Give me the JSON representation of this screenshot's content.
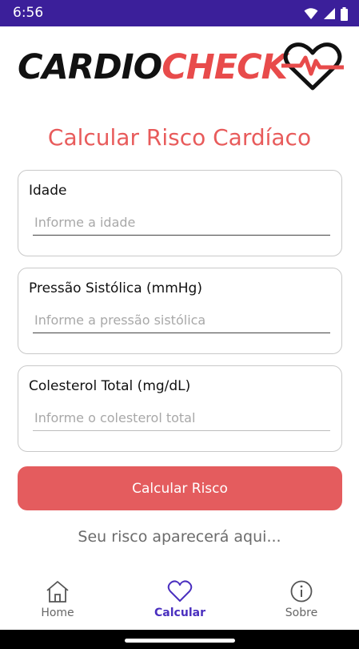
{
  "status": {
    "time": "6:56"
  },
  "logo": {
    "part1": "CARDIO",
    "part2": "CHECK"
  },
  "title": "Calcular Risco Cardíaco",
  "fields": [
    {
      "label": "Idade",
      "placeholder": "Informe a idade"
    },
    {
      "label": "Pressão Sistólica (mmHg)",
      "placeholder": "Informe a pressão sistólica"
    },
    {
      "label": "Colesterol Total (mg/dL)",
      "placeholder": "Informe o colesterol total"
    }
  ],
  "button": {
    "label": "Calcular Risco"
  },
  "result": "Seu risco aparecerá aqui...",
  "nav": [
    {
      "label": "Home",
      "icon": "home-icon"
    },
    {
      "label": "Calcular",
      "icon": "heart-icon",
      "active": true
    },
    {
      "label": "Sobre",
      "icon": "info-icon"
    }
  ],
  "colors": {
    "status_bar": "#3b1f9a",
    "accent": "#e45c5e",
    "nav_active": "#4a2fbf"
  }
}
